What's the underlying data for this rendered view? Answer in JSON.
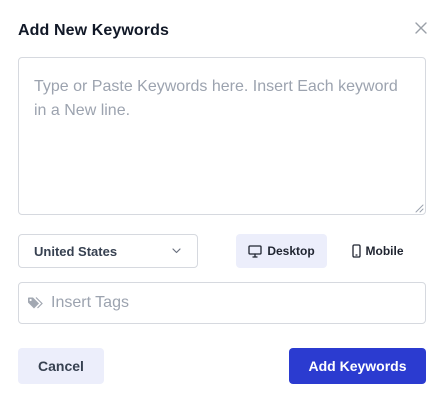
{
  "dialog": {
    "title": "Add New Keywords"
  },
  "keywords_input": {
    "value": "",
    "placeholder": "Type or Paste Keywords here. Insert Each keyword in a New line."
  },
  "country_select": {
    "selected": "United States"
  },
  "device_toggle": {
    "desktop_label": "Desktop",
    "mobile_label": "Mobile",
    "active": "Desktop"
  },
  "tags_input": {
    "value": "",
    "placeholder": "Insert Tags"
  },
  "actions": {
    "cancel_label": "Cancel",
    "submit_label": "Add Keywords"
  },
  "colors": {
    "primary": "#2b3bd0",
    "secondary_bg": "#eceefb",
    "border": "#d6d9df",
    "placeholder": "#9ca3af"
  },
  "icons": {
    "close": "close-icon",
    "chevron": "chevron-down-icon",
    "desktop": "desktop-icon",
    "mobile": "mobile-icon",
    "tag": "tag-icon"
  }
}
